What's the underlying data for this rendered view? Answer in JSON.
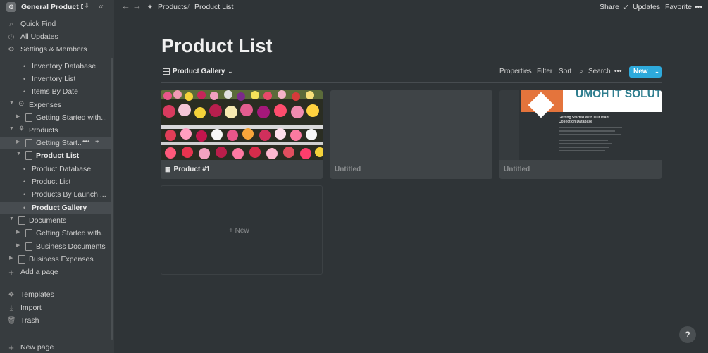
{
  "workspace": {
    "logo": "G",
    "name": "General Product D..."
  },
  "sidebar": {
    "top": [
      {
        "label": "Quick Find",
        "icon": "search-icon"
      },
      {
        "label": "All Updates",
        "icon": "clock-icon"
      },
      {
        "label": "Settings & Members",
        "icon": "gear-icon"
      }
    ],
    "tree": [
      {
        "label": "Inventory Database"
      },
      {
        "label": "Inventory List"
      },
      {
        "label": "Items By Date"
      },
      {
        "label": "Expenses",
        "icon": "coin-icon"
      },
      {
        "label": "Getting Started with..."
      },
      {
        "label": "Products",
        "icon": "plant-icon"
      },
      {
        "label": "Getting Start..."
      },
      {
        "label": "Product List"
      },
      {
        "label": "Product Database"
      },
      {
        "label": "Product List"
      },
      {
        "label": "Products By Launch ..."
      },
      {
        "label": "Product Gallery"
      },
      {
        "label": "Documents",
        "icon": "document-icon"
      },
      {
        "label": "Getting Started with..."
      },
      {
        "label": "Business Documents"
      },
      {
        "label": "Business Expenses"
      }
    ],
    "add_page": "Add a page",
    "bottom": [
      {
        "label": "Templates",
        "icon": "templates-icon"
      },
      {
        "label": "Import",
        "icon": "import-icon"
      },
      {
        "label": "Trash",
        "icon": "trash-icon"
      }
    ],
    "new_page": "New page"
  },
  "topbar": {
    "breadcrumb": [
      "Products",
      "/",
      "Product List"
    ],
    "share": "Share",
    "updates": "Updates",
    "favorite": "Favorite",
    "more": "•••"
  },
  "page": {
    "title": "Product List",
    "view": "Product Gallery",
    "toolbar": {
      "properties": "Properties",
      "filter": "Filter",
      "sort": "Sort",
      "search": "Search",
      "more": "•••",
      "new": "New"
    }
  },
  "gallery": {
    "cards": [
      {
        "title": "Product #1",
        "cover": "flowers-photo"
      },
      {
        "title": "Untitled",
        "cover": "none"
      },
      {
        "title": "Untitled",
        "cover": "document-preview",
        "preview_banner": "UMOH IT SOLUTIONS",
        "preview_heading": "Getting Started With Our Plant Collection Database"
      }
    ],
    "new_label": "+ New"
  },
  "help": "?",
  "colors": {
    "sidebar": "#373c3f",
    "main": "#2f3437",
    "accent": "#2eaadc",
    "banner_orange": "#e4743c",
    "banner_teal": "#2f7e8f"
  }
}
